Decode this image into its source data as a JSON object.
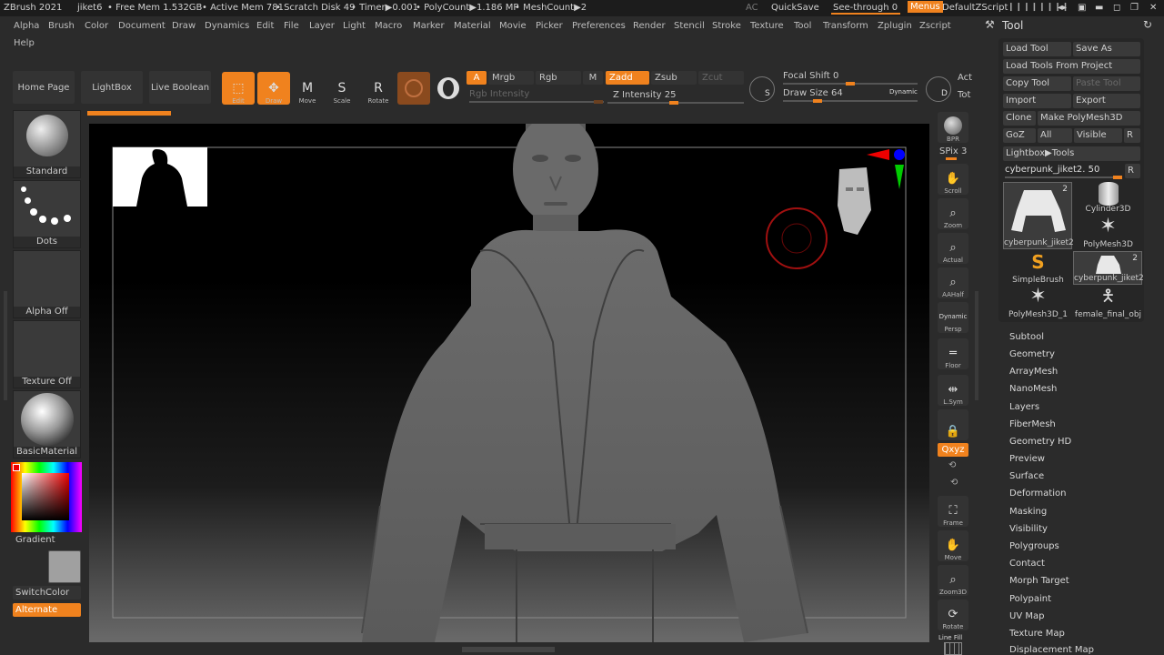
{
  "titlebar": {
    "app": "ZBrush 2021",
    "doc": "jiket6",
    "free_mem": "• Free Mem 1.532GB",
    "active_mem": "• Active Mem 781",
    "scratch": "• Scratch Disk 49",
    "timer": "• Timer▶0.001",
    "polycount": "• PolyCount▶1.186 MP",
    "meshcount": "• MeshCount▶2",
    "ac": "AC",
    "quicksave": "QuickSave",
    "see_through": "See-through 0",
    "menus": "Menus",
    "script": "DefaultZScript"
  },
  "menubar": {
    "items": [
      "Alpha",
      "Brush",
      "Color",
      "Document",
      "Draw",
      "Dynamics",
      "Edit",
      "File",
      "Layer",
      "Light",
      "Macro",
      "Marker",
      "Material",
      "Movie",
      "Picker",
      "Preferences",
      "Render",
      "Stencil",
      "Stroke",
      "Texture",
      "Tool",
      "Transform",
      "Zplugin",
      "Zscript"
    ],
    "help": "Help"
  },
  "shelf": {
    "home_page": "Home Page",
    "lightbox": "LightBox",
    "live_boolean": "Live Boolean",
    "edit": "Edit",
    "draw": "Draw",
    "move": "Move",
    "scale": "Scale",
    "rotate": "Rotate",
    "a": "A",
    "mrgb": "Mrgb",
    "rgb": "Rgb",
    "m": "M",
    "rgb_intensity": "Rgb Intensity",
    "zadd": "Zadd",
    "zsub": "Zsub",
    "zcut": "Zcut",
    "z_intensity": "Z Intensity 25",
    "focal_shift": "Focal Shift 0",
    "draw_size": "Draw Size 64",
    "dynamic": "Dynamic",
    "act": "Act",
    "tot": "Tot"
  },
  "left": {
    "brush": "Standard",
    "stroke": "Dots",
    "alpha": "Alpha Off",
    "texture": "Texture Off",
    "material": "BasicMaterial",
    "gradient": "Gradient",
    "switch_color": "SwitchColor",
    "alternate": "Alternate"
  },
  "right_strip": {
    "bpr": "BPR",
    "spix": "SPix 3",
    "scroll": "Scroll",
    "zoom": "Zoom",
    "actual": "Actual",
    "aahalf": "AAHalf",
    "dynamic": "Dynamic",
    "persp": "Persp",
    "floor": "Floor",
    "lsym": "L.Sym",
    "xyz": "Qxyz",
    "frame": "Frame",
    "move": "Move",
    "zoom3d": "Zoom3D",
    "rotate": "Rotate",
    "line_fill": "Line Fill"
  },
  "tool": {
    "title": "Tool",
    "load_tool": "Load Tool",
    "save_as": "Save As",
    "load_from_project": "Load Tools From Project",
    "copy_tool": "Copy Tool",
    "paste_tool": "Paste Tool",
    "import": "Import",
    "export": "Export",
    "clone": "Clone",
    "make_polymesh": "Make PolyMesh3D",
    "goz": "GoZ",
    "all": "All",
    "visible": "Visible",
    "r": "R",
    "lightbox_tools": "Lightbox▶Tools",
    "current_tool": "cyberpunk_jiket2. 50",
    "grid": [
      {
        "name": "cyberpunk_jiket2",
        "badge": "2"
      },
      {
        "name": "Cylinder3D",
        "badge": ""
      },
      {
        "name": "PolyMesh3D",
        "badge": ""
      },
      {
        "name": "SimpleBrush",
        "badge": ""
      },
      {
        "name": "cyberpunk_jiket2",
        "badge": "2"
      },
      {
        "name": "PolyMesh3D_1",
        "badge": ""
      },
      {
        "name": "female_final_obj",
        "badge": ""
      }
    ],
    "subpalettes": [
      "Subtool",
      "Geometry",
      "ArrayMesh",
      "NanoMesh",
      "Layers",
      "FiberMesh",
      "Geometry HD",
      "Preview",
      "Surface",
      "Deformation",
      "Masking",
      "Visibility",
      "Polygroups",
      "Contact",
      "Morph Target",
      "Polypaint",
      "UV Map",
      "Texture Map",
      "Displacement Map"
    ]
  },
  "colors": {
    "accent": "#f0821e",
    "bg": "#2b2b2b",
    "canvas": "#000000"
  }
}
